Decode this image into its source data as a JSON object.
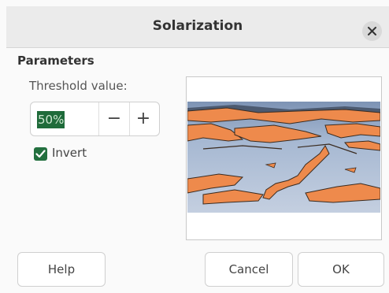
{
  "dialog": {
    "title": "Solarization",
    "close_icon": "close-icon"
  },
  "parameters": {
    "section_title": "Parameters",
    "threshold_label": "Threshold value:",
    "threshold_value": "50%",
    "decrement_label": "−",
    "increment_label": "+",
    "invert_label": "Invert",
    "invert_checked": true
  },
  "preview": {
    "image_icon": "solarized-preview-image"
  },
  "buttons": {
    "help": "Help",
    "cancel": "Cancel",
    "ok": "OK"
  },
  "colors": {
    "accent": "#23703f",
    "selection_bg": "#1f6b3a",
    "preview_sky": "#a3b8d4",
    "preview_orange": "#ee8a4c"
  }
}
